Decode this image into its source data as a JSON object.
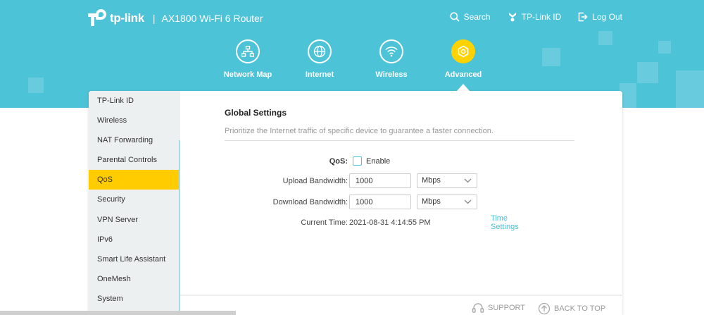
{
  "brand": {
    "logo_text": "tp-link",
    "separator": "|",
    "model": "AX1800 Wi-Fi 6 Router"
  },
  "top_nav": [
    {
      "label": "Search",
      "icon": "search-icon"
    },
    {
      "label": "TP-Link ID",
      "icon": "tplink-id-icon"
    },
    {
      "label": "Log Out",
      "icon": "logout-icon"
    }
  ],
  "main_nav": [
    {
      "label": "Network Map",
      "icon": "network-map-icon",
      "active": false
    },
    {
      "label": "Internet",
      "icon": "globe-icon",
      "active": false
    },
    {
      "label": "Wireless",
      "icon": "wifi-icon",
      "active": false
    },
    {
      "label": "Advanced",
      "icon": "gear-icon",
      "active": true
    }
  ],
  "sidebar": {
    "items": [
      {
        "label": "TP-Link ID"
      },
      {
        "label": "Wireless"
      },
      {
        "label": "NAT Forwarding"
      },
      {
        "label": "Parental Controls"
      },
      {
        "label": "QoS",
        "active": true
      },
      {
        "label": "Security"
      },
      {
        "label": "VPN Server"
      },
      {
        "label": "IPv6"
      },
      {
        "label": "Smart Life Assistant"
      },
      {
        "label": "OneMesh"
      },
      {
        "label": "System"
      }
    ]
  },
  "content": {
    "title": "Global Settings",
    "description": "Prioritize the Internet traffic of specific device to guarantee a faster connection.",
    "qos": {
      "label": "QoS:",
      "checkbox_label": "Enable",
      "checked": false
    },
    "upload": {
      "label": "Upload Bandwidth:",
      "value": "1000",
      "unit": "Mbps"
    },
    "download": {
      "label": "Download Bandwidth:",
      "value": "1000",
      "unit": "Mbps"
    },
    "current_time": {
      "label": "Current Time:",
      "value": "2021-08-31 4:14:55 PM",
      "link": "Time Settings"
    }
  },
  "footer": {
    "support": "SUPPORT",
    "back_to_top": "BACK TO TOP"
  },
  "colors": {
    "header": "#4dc3d8",
    "active": "#ffcc00",
    "link": "#4dc3d8",
    "sidebar_bg": "#ecf0f1"
  }
}
